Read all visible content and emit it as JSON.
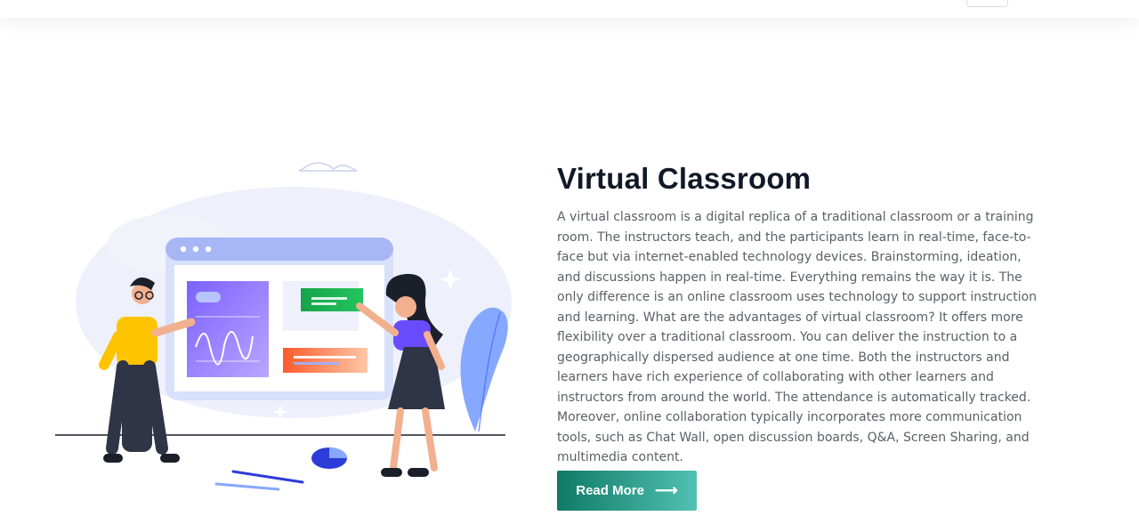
{
  "section": {
    "title": "Virtual Classroom",
    "description": "A virtual classroom is a digital replica of a traditional classroom or a training room. The instructors teach, and the participants learn in real-time, face-to-face but via internet-enabled technology devices. Brainstorming, ideation, and discussions happen in real-time. Everything remains the way it is. The only difference is an online classroom uses technology to support instruction and learning. What are the advantages of virtual classroom? It offers more flexibility over a traditional classroom. You can deliver the instruction to a geographically dispersed audience at one time. Both the instructors and learners have rich experience of collaborating with other learners and instructors from around the world. The attendance is automatically tracked. Moreover, online collaboration typically incorporates more communication tools, such as Chat Wall, open discussion boards, Q&A, Screen Sharing, and multimedia content.",
    "button_label": "Read More",
    "button_icon": "⟶"
  },
  "illustration": {
    "name": "virtual-classroom-illustration",
    "colors": {
      "bubble": "#eef0fb",
      "screen_top": "#a7b7f5",
      "screen_frame": "#dfe6fb",
      "chart_purple": "#7b61ff",
      "chart_green": "#22c55e",
      "chart_orange": "#ff7a45",
      "plant": "#86a8ff"
    }
  }
}
